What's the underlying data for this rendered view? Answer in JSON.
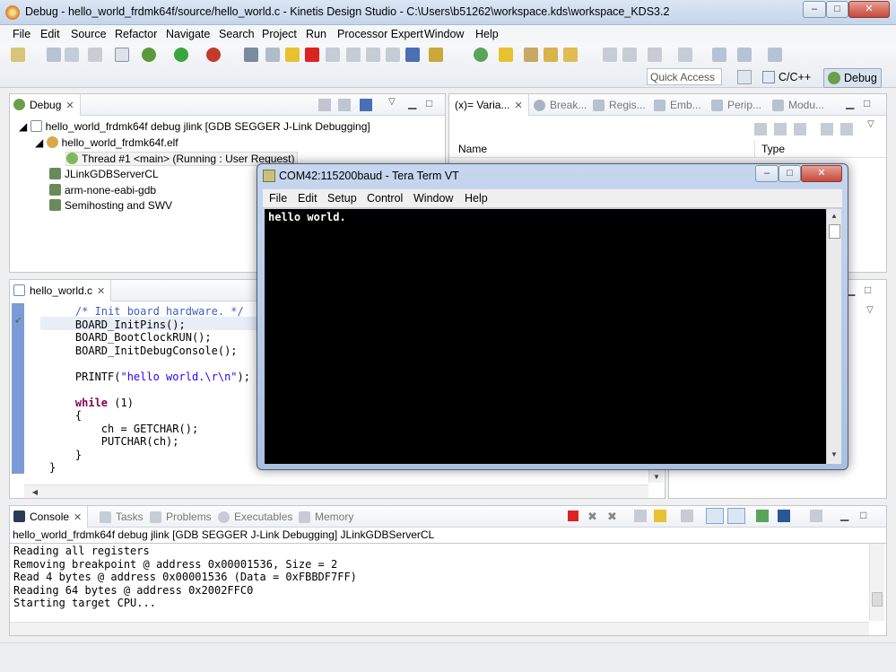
{
  "window": {
    "title": "Debug - hello_world_frdmk64f/source/hello_world.c - Kinetis Design Studio - C:\\Users\\b51262\\workspace.kds\\workspace_KDS3.2",
    "minimize": "–",
    "maximize": "□",
    "close": "✕"
  },
  "menu": [
    "File",
    "Edit",
    "Source",
    "Refactor",
    "Navigate",
    "Search",
    "Project",
    "Run",
    "Processor Expert",
    "Window",
    "Help"
  ],
  "toolbar": {
    "quick_access": "Quick Access",
    "perspectives": [
      "C/C++",
      "Debug"
    ]
  },
  "debug_view": {
    "tab": "Debug",
    "rows": [
      "hello_world_frdmk64f debug jlink [GDB SEGGER J-Link Debugging]",
      "hello_world_frdmk64f.elf",
      "Thread #1 <main> (Running : User Request)",
      "JLinkGDBServerCL",
      "arm-none-eabi-gdb",
      "Semihosting and SWV"
    ]
  },
  "variables_view": {
    "tabs": [
      "(x)= Varia...",
      "Break...",
      "Regis...",
      "Emb...",
      "Perip...",
      "Modu..."
    ],
    "columns": [
      "Name",
      "Type"
    ]
  },
  "editor": {
    "tab": "hello_world.c",
    "lines": [
      {
        "t": "    /* Init board hardware. */",
        "k": "cmt"
      },
      {
        "t": "    BOARD_InitPins();",
        "k": ""
      },
      {
        "t": "    BOARD_BootClockRUN();",
        "k": ""
      },
      {
        "t": "    BOARD_InitDebugConsole();",
        "k": ""
      },
      {
        "t": "",
        "k": ""
      },
      {
        "t": "    PRINTF(\"hello world.\\r\\n\");",
        "k": "printf"
      },
      {
        "t": "",
        "k": ""
      },
      {
        "t": "    while (1)",
        "k": "while"
      },
      {
        "t": "    {",
        "k": ""
      },
      {
        "t": "        ch = GETCHAR();",
        "k": ""
      },
      {
        "t": "        PUTCHAR(ch);",
        "k": ""
      },
      {
        "t": "    }",
        "k": ""
      },
      {
        "t": "}",
        "k": ""
      }
    ]
  },
  "console": {
    "tabs": [
      "Console",
      "Tasks",
      "Problems",
      "Executables",
      "Memory"
    ],
    "header": "hello_world_frdmk64f debug jlink [GDB SEGGER J-Link Debugging] JLinkGDBServerCL",
    "lines": [
      "Reading all registers",
      "Removing breakpoint @ address 0x00001536, Size = 2",
      "Read 4 bytes @ address 0x00001536 (Data = 0xFBBDF7FF)",
      "Reading 64 bytes @ address 0x2002FFC0",
      "Starting target CPU..."
    ]
  },
  "teraterm": {
    "title": "COM42:115200baud - Tera Term VT",
    "menu": [
      "File",
      "Edit",
      "Setup",
      "Control",
      "Window",
      "Help"
    ],
    "output": "hello world."
  },
  "colors": {
    "accent": "#2b5797",
    "keyword": "#7f0055",
    "string": "#2a00ff",
    "comment": "#3f5fbf"
  }
}
